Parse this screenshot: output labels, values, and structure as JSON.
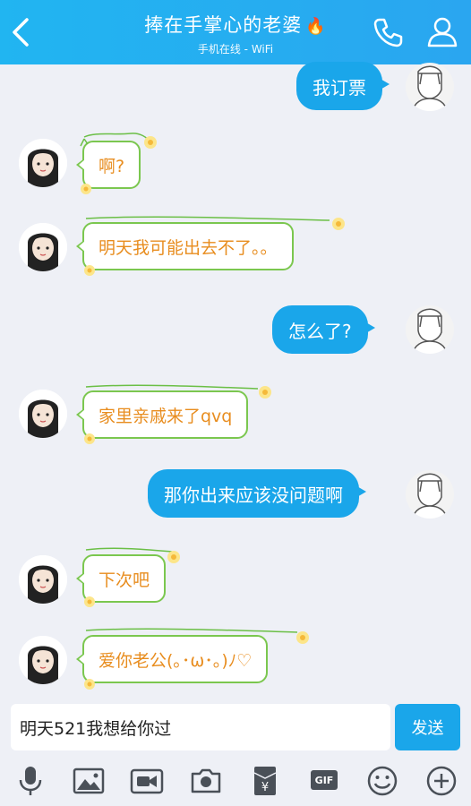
{
  "header": {
    "title": "捧在手掌心的老婆",
    "status": "手机在线 - WiFi"
  },
  "messages": [
    {
      "side": "right",
      "text": "我订票"
    },
    {
      "side": "left",
      "text": "啊?"
    },
    {
      "side": "left",
      "text": "明天我可能出去不了。。"
    },
    {
      "side": "right",
      "text": "怎么了?"
    },
    {
      "side": "left",
      "text": "家里亲戚来了qvq"
    },
    {
      "side": "right",
      "text": "那你出来应该没问题啊"
    },
    {
      "side": "left",
      "text": "下次吧"
    },
    {
      "side": "left",
      "text": "爱你老公(｡･ω･｡)ﾉ♡"
    }
  ],
  "input": {
    "value": "明天521我想给你过"
  },
  "send_label": "发送",
  "toolbar": {
    "gif_label": "GIF"
  },
  "colors": {
    "header": "#21b5f1",
    "sent_bubble": "#1aa6ea",
    "received_text": "#e88d1f",
    "received_border": "#7bc74f",
    "background": "#eef0f6"
  }
}
